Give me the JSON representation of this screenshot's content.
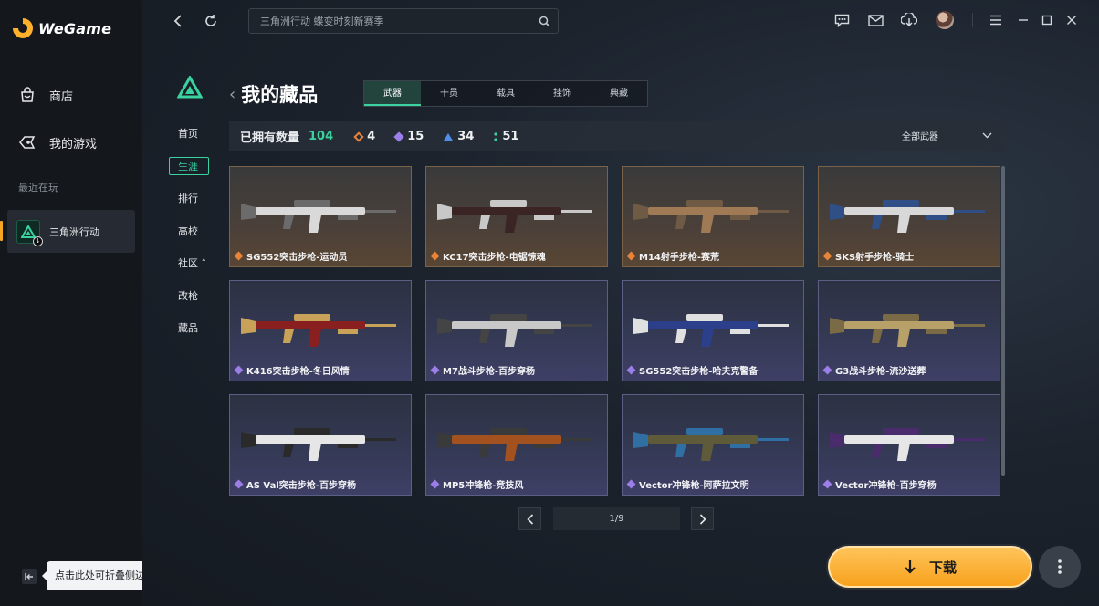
{
  "app": {
    "brand": "WeGame"
  },
  "sidebar": {
    "items": [
      {
        "label": "商店",
        "icon": "shop-bag-icon"
      },
      {
        "label": "我的游戏",
        "icon": "gamepad-icon"
      }
    ],
    "recent_label": "最近在玩",
    "recent_game": "三角洲行动",
    "collapse_tooltip": "点击此处可折叠侧边栏"
  },
  "topbar": {
    "search_placeholder": "三角洲行动 蝶变时刻新赛季"
  },
  "game_nav": {
    "items": [
      "首页",
      "生涯",
      "排行",
      "高校",
      "社区 ˄",
      "改枪",
      "藏品"
    ],
    "active_index": 1
  },
  "page": {
    "title": "我的藏品",
    "tabs": [
      "武器",
      "干员",
      "载具",
      "挂饰",
      "典藏"
    ],
    "active_tab": 0
  },
  "stats": {
    "owned_label": "已拥有数量",
    "owned_total": "104",
    "counts": [
      {
        "value": "4",
        "color": "#e8843a"
      },
      {
        "value": "15",
        "color": "#9b7ee8"
      },
      {
        "value": "34",
        "color": "#4f8fe8"
      },
      {
        "value": "51",
        "color": "#3ad3a0"
      }
    ],
    "filter_label": "全部武器"
  },
  "items": [
    {
      "name": "SG552突击步枪-运动员",
      "rarity": "gold"
    },
    {
      "name": "KC17突击步枪-电锯惊魂",
      "rarity": "gold"
    },
    {
      "name": "M14射手步枪-赛荒",
      "rarity": "gold"
    },
    {
      "name": "SKS射手步枪-骑士",
      "rarity": "gold"
    },
    {
      "name": "K416突击步枪-冬日风情",
      "rarity": "purple"
    },
    {
      "name": "M7战斗步枪-百步穿杨",
      "rarity": "purple"
    },
    {
      "name": "SG552突击步枪-哈夫克警备",
      "rarity": "purple"
    },
    {
      "name": "G3战斗步枪-流沙送葬",
      "rarity": "purple"
    },
    {
      "name": "AS Val突击步枪-百步穿杨",
      "rarity": "purple"
    },
    {
      "name": "MP5冲锋枪-竞技风",
      "rarity": "purple"
    },
    {
      "name": "Vector冲锋枪-阿萨拉文明",
      "rarity": "purple"
    },
    {
      "name": "Vector冲锋枪-百步穿杨",
      "rarity": "purple"
    }
  ],
  "pager": {
    "text": "1/9"
  },
  "download": {
    "label": "下载"
  },
  "colors": {
    "accent": "#3ad3a0",
    "gold": "#e8843a",
    "purple": "#9b7ee8",
    "download": "#f7a21e"
  }
}
